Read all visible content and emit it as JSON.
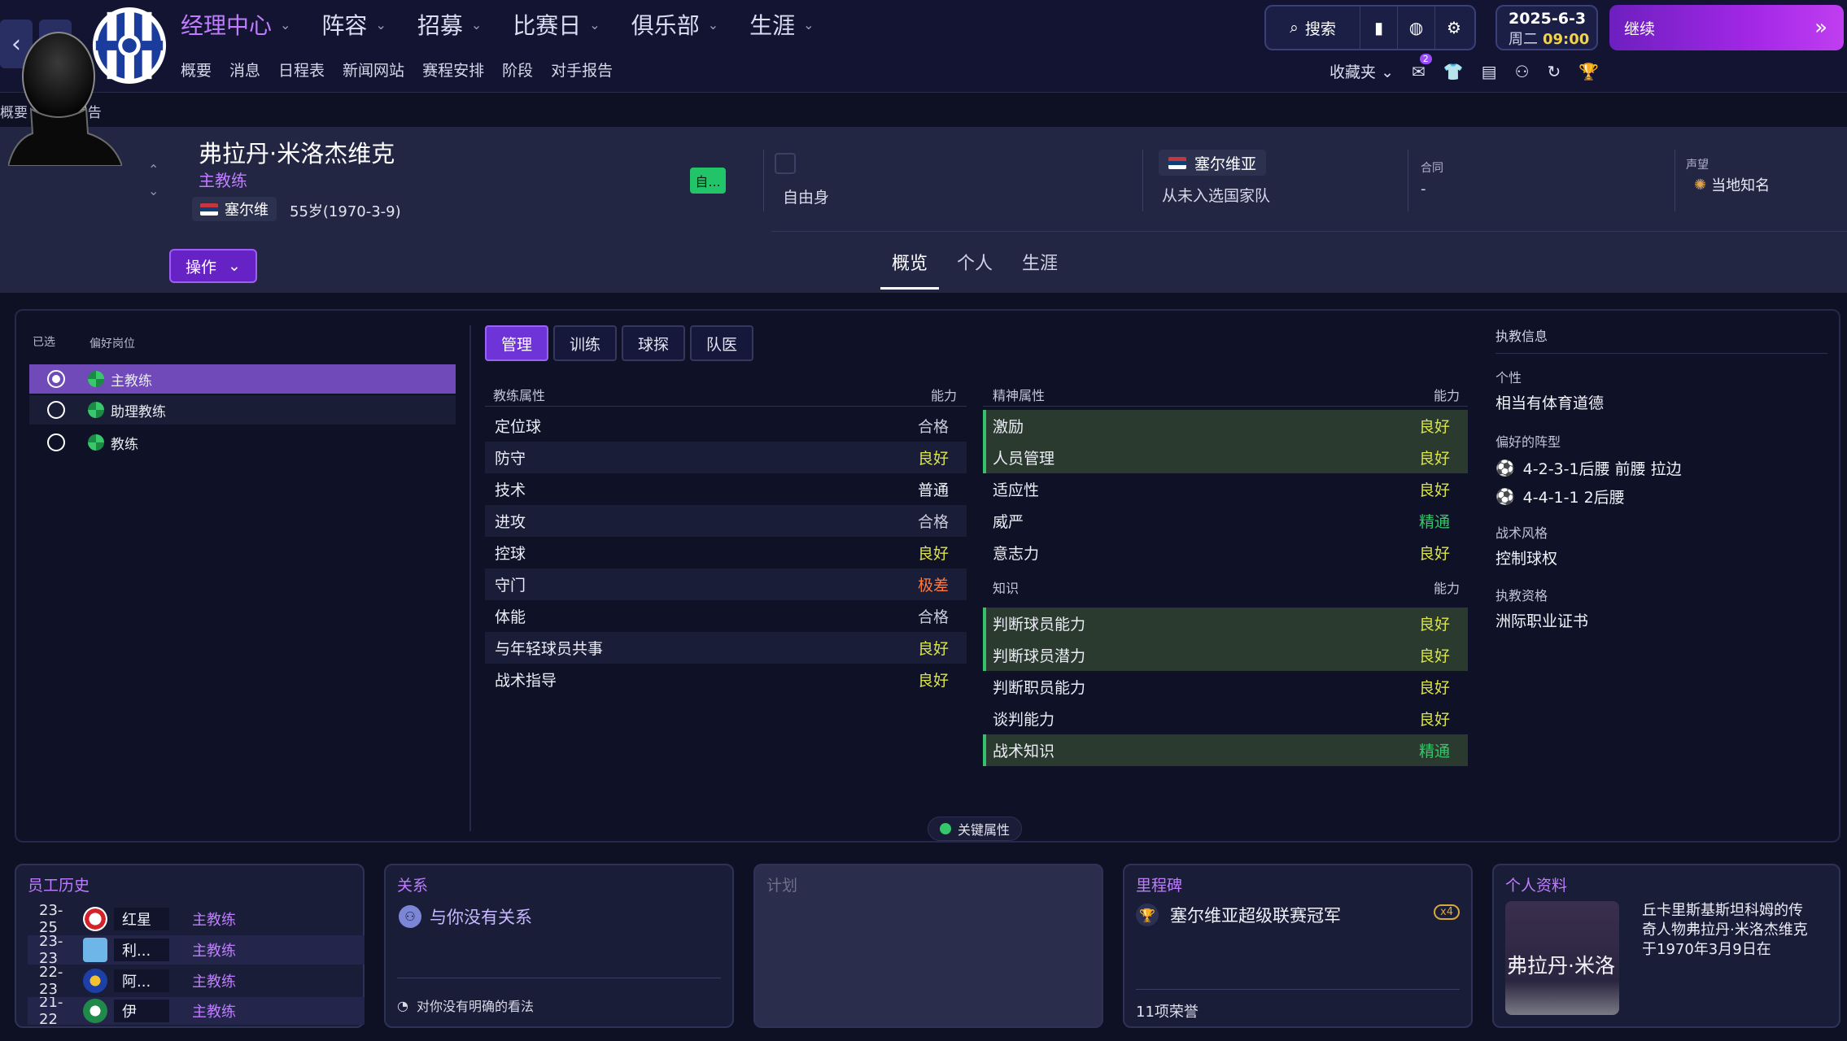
{
  "nav": {
    "main": [
      "经理中心",
      "阵容",
      "招募",
      "比赛日",
      "俱乐部",
      "生涯"
    ],
    "sub": [
      "概要",
      "消息",
      "日程表",
      "新闻网站",
      "赛程安排",
      "阶段",
      "对手报告"
    ],
    "search": "搜索",
    "date": "2025-6-3",
    "weekday": "周二",
    "time": "09:00",
    "continue": "继续",
    "favorites": "收藏夹",
    "msg_badge": "2"
  },
  "breadcrumb": [
    "概要",
    "职员报告"
  ],
  "profile": {
    "name": "弗拉丹·米洛杰维克",
    "role": "主教练",
    "nationality_short": "塞尔维",
    "age": "55岁(1970-3-9)",
    "status_badge": "自...",
    "action": "操作",
    "contract_status": "自由身",
    "nation": "塞尔维亚",
    "national_team": "从未入选国家队",
    "contract_label": "合同",
    "contract_value": "-",
    "reputation_label": "声望",
    "reputation_value": "当地知名",
    "tabs": [
      "概览",
      "个人",
      "生涯"
    ]
  },
  "positions": {
    "header_selected": "已选",
    "header_pref": "偏好岗位",
    "items": [
      "主教练",
      "助理教练",
      "教练"
    ]
  },
  "subtabs": [
    "管理",
    "训练",
    "球探",
    "队医"
  ],
  "coaching": {
    "title": "教练属性",
    "ability": "能力",
    "rows": [
      {
        "name": "定位球",
        "level": "合格"
      },
      {
        "name": "防守",
        "level": "良好"
      },
      {
        "name": "技术",
        "level": "普通"
      },
      {
        "name": "进攻",
        "level": "合格"
      },
      {
        "name": "控球",
        "level": "良好"
      },
      {
        "name": "守门",
        "level": "极差"
      },
      {
        "name": "体能",
        "level": "合格"
      },
      {
        "name": "与年轻球员共事",
        "level": "良好"
      },
      {
        "name": "战术指导",
        "level": "良好"
      }
    ]
  },
  "mental": {
    "title": "精神属性",
    "ability": "能力",
    "rows": [
      {
        "name": "激励",
        "level": "良好"
      },
      {
        "name": "人员管理",
        "level": "良好"
      },
      {
        "name": "适应性",
        "level": "良好"
      },
      {
        "name": "威严",
        "level": "精通"
      },
      {
        "name": "意志力",
        "level": "良好"
      }
    ]
  },
  "knowledge": {
    "title": "知识",
    "ability": "能力",
    "rows": [
      {
        "name": "判断球员能力",
        "level": "良好"
      },
      {
        "name": "判断球员潜力",
        "level": "良好"
      },
      {
        "name": "判断职员能力",
        "level": "良好"
      },
      {
        "name": "谈判能力",
        "level": "良好"
      },
      {
        "name": "战术知识",
        "level": "精通"
      }
    ]
  },
  "coach_info": {
    "title": "执教信息",
    "personality_label": "个性",
    "personality": "相当有体育道德",
    "formation_label": "偏好的阵型",
    "formations": [
      "4-2-3-1后腰 前腰 拉边",
      "4-4-1-1 2后腰"
    ],
    "style_label": "战术风格",
    "style": "控制球权",
    "license_label": "执教资格",
    "license": "洲际职业证书"
  },
  "key_attr": "关键属性",
  "history": {
    "title": "员工历史",
    "rows": [
      {
        "years": "23-25",
        "club": "红星",
        "role": "主教练"
      },
      {
        "years": "23-23",
        "club": "利...",
        "role": "主教练"
      },
      {
        "years": "22-23",
        "club": "阿...",
        "role": "主教练"
      },
      {
        "years": "21-22",
        "club": "伊",
        "role": "主教练"
      }
    ]
  },
  "relations": {
    "title": "关系",
    "text": "与你没有关系",
    "footer": "对你没有明确的看法"
  },
  "plan": {
    "title": "计划"
  },
  "milestones": {
    "title": "里程碑",
    "item": "塞尔维亚超级联赛冠军",
    "count": "x4",
    "footer": "11项荣誉"
  },
  "bio": {
    "title": "个人资料",
    "name_art": "弗拉丹·米洛",
    "text": "丘卡里斯基斯坦科姆的传奇人物弗拉丹·米洛杰维克于1970年3月9日在"
  },
  "colors": {
    "accent": "#c07cff",
    "good": "#d9e34a",
    "master": "#34c86a",
    "bad": "#ff7a3a"
  }
}
